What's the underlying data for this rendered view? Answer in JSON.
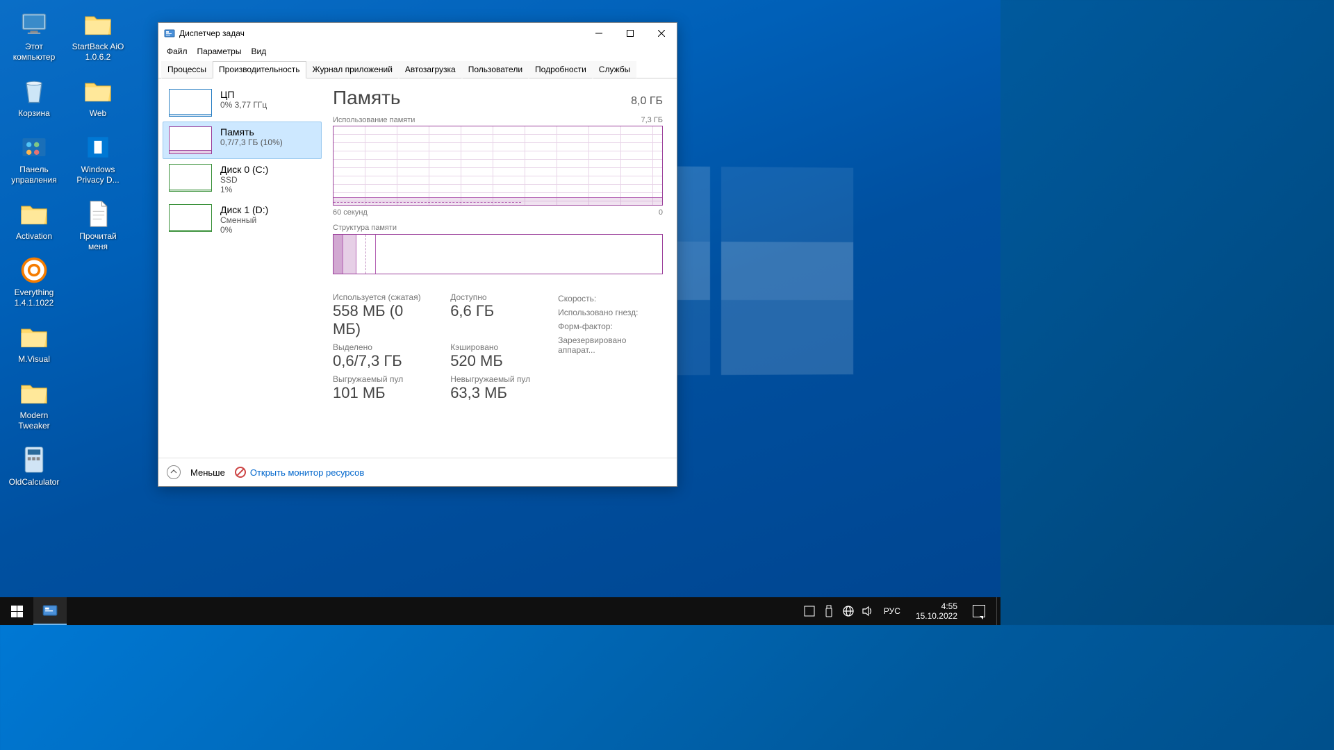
{
  "desktop_icons": [
    {
      "label": "Этот\nкомпьютер",
      "type": "pc"
    },
    {
      "label": "Корзина",
      "type": "bin"
    },
    {
      "label": "Панель\nуправления",
      "type": "panel"
    },
    {
      "label": "Activation",
      "type": "folder"
    },
    {
      "label": "Everything\n1.4.1.1022",
      "type": "ev"
    },
    {
      "label": "M.Visual",
      "type": "folder"
    },
    {
      "label": "Modern\nTweaker",
      "type": "folder"
    },
    {
      "label": "OldCalculator",
      "type": "calc"
    },
    {
      "label": "StartBack AiO\n1.0.6.2",
      "type": "folder"
    },
    {
      "label": "Web",
      "type": "folder"
    },
    {
      "label": "Windows\nPrivacy D...",
      "type": "winp"
    },
    {
      "label": "Прочитай\nменя",
      "type": "txt"
    }
  ],
  "tm": {
    "title": "Диспетчер задач",
    "menu": [
      "Файл",
      "Параметры",
      "Вид"
    ],
    "tabs": [
      "Процессы",
      "Производительность",
      "Журнал приложений",
      "Автозагрузка",
      "Пользователи",
      "Подробности",
      "Службы"
    ],
    "active_tab": 1,
    "sidebar": [
      {
        "title": "ЦП",
        "sub": "0%  3,77 ГГц",
        "type": "cpu"
      },
      {
        "title": "Память",
        "sub": "0,7/7,3 ГБ (10%)",
        "type": "mem",
        "selected": true
      },
      {
        "title": "Диск 0 (C:)",
        "sub": "SSD\n1%",
        "type": "disk"
      },
      {
        "title": "Диск 1 (D:)",
        "sub": "Сменный\n0%",
        "type": "disk"
      }
    ],
    "main": {
      "heading": "Память",
      "capacity": "8,0 ГБ",
      "usage_label": "Использование памяти",
      "usage_max": "7,3 ГБ",
      "x_left": "60 секунд",
      "x_right": "0",
      "comp_label": "Структура памяти",
      "stats": [
        {
          "lab": "Используется (сжатая)",
          "val": "558 МБ (0 МБ)"
        },
        {
          "lab": "Доступно",
          "val": "6,6 ГБ"
        },
        {
          "lab": "Выделено",
          "val": "0,6/7,3 ГБ"
        },
        {
          "lab": "Кэшировано",
          "val": "520 МБ"
        },
        {
          "lab": "Выгружаемый пул",
          "val": "101 МБ"
        },
        {
          "lab": "Невыгружаемый пул",
          "val": "63,3 МБ"
        }
      ],
      "right_labels": [
        "Скорость:",
        "Использовано гнезд:",
        "Форм-фактор:",
        "Зарезервировано аппарат..."
      ]
    },
    "footer": {
      "less": "Меньше",
      "link": "Открыть монитор ресурсов"
    }
  },
  "taskbar": {
    "lang": "РУС",
    "time": "4:55",
    "date": "15.10.2022"
  }
}
